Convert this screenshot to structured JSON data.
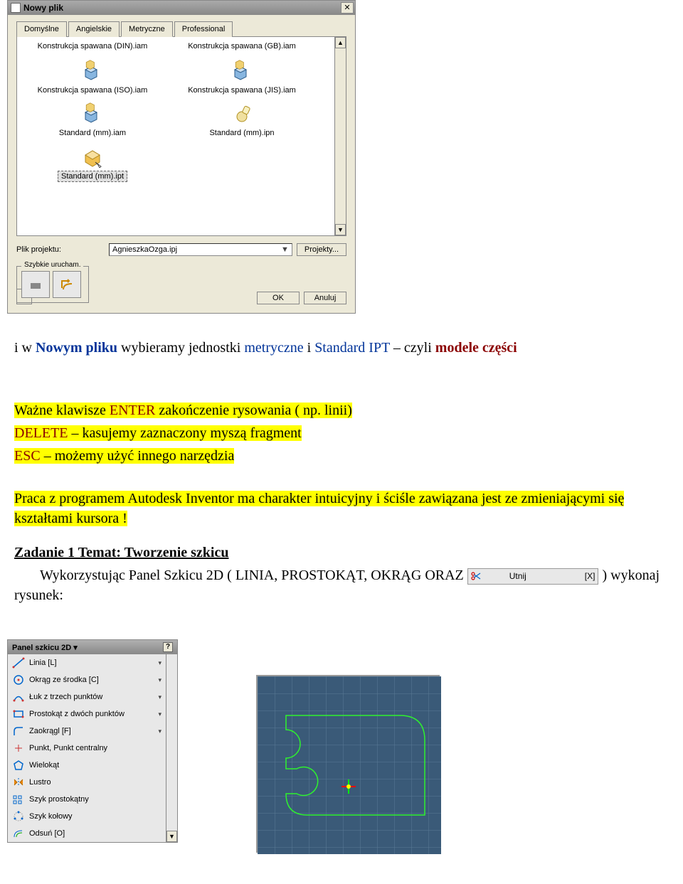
{
  "dialog": {
    "title": "Nowy plik",
    "tabs": [
      "Domyślne",
      "Angielskie",
      "Metryczne",
      "Professional"
    ],
    "active_tab": 2,
    "files": [
      {
        "label": "Konstrukcja spawana (DIN).iam",
        "type": "iam",
        "truncated": true
      },
      {
        "label": "Konstrukcja spawana (GB).iam",
        "type": "iam",
        "truncated": true
      },
      {
        "label": "Konstrukcja spawana (ISO).iam",
        "type": "iam"
      },
      {
        "label": "Konstrukcja spawana (JIS).iam",
        "type": "iam"
      },
      {
        "label": "Standard (mm).iam",
        "type": "iam"
      },
      {
        "label": "Standard (mm).ipn",
        "type": "ipn"
      },
      {
        "label": "Standard (mm).ipt",
        "type": "ipt",
        "selected": true
      }
    ],
    "project_label": "Plik projektu:",
    "project_value": "AgnieszkaOzga.ipj",
    "projects_btn": "Projekty...",
    "quick_launch_label": "Szybkie urucham.",
    "ok": "OK",
    "cancel": "Anuluj"
  },
  "doc": {
    "line1_pre": "i w ",
    "line1_blue1": "Nowym pliku",
    "line1_mid": " wybieramy jednostki ",
    "line1_blue2": "metryczne",
    "line1_mid2": " i ",
    "line1_blue3": "Standard IPT",
    "line1_mid3": " – czyli ",
    "line1_red": "modele części",
    "keys_pre": "Ważne klawisze ",
    "keys_enter": "ENTER",
    "keys_enter_desc": "  zakończenie rysowania ( np. linii)",
    "keys_delete": " DELETE",
    "keys_delete_desc": " – kasujemy zaznaczony myszą fragment",
    "keys_esc": " ESC",
    "keys_esc_desc": " – możemy użyć  innego narzędzia",
    "para2": "Praca z programem Autodesk Inventor ma charakter intuicyjny i ściśle zawiązana jest ze zmieniającymi się kształtami kursora !",
    "task_title": "Zadanie 1 Temat: Tworzenie szkicu",
    "task_text": "Wykorzystując Panel Szkicu 2D ( LINIA, PROSTOKĄT, OKRĄG ORAZ ",
    "utnij_label": "Utnij",
    "utnij_key": "[X]",
    "task_tail": ") wykonaj rysunek:"
  },
  "panel": {
    "title": "Panel szkicu 2D",
    "help": "?",
    "tools": [
      {
        "label": "Linia  [L]",
        "icon": "line",
        "arrow": true
      },
      {
        "label": "Okrąg ze środka   [C]",
        "icon": "circle",
        "arrow": true
      },
      {
        "label": "Łuk z trzech punktów",
        "icon": "arc",
        "arrow": true
      },
      {
        "label": "Prostokąt z dwóch punktów",
        "icon": "rect",
        "arrow": true
      },
      {
        "label": "Zaokrągl  [F]",
        "icon": "fillet",
        "arrow": true
      },
      {
        "label": "Punkt, Punkt centralny",
        "icon": "point"
      },
      {
        "label": "Wielokąt",
        "icon": "polygon"
      },
      {
        "label": "Lustro",
        "icon": "mirror"
      },
      {
        "label": "Szyk prostokątny",
        "icon": "rectarray"
      },
      {
        "label": "Szyk kołowy",
        "icon": "circarray"
      },
      {
        "label": "Odsuń  [O]",
        "icon": "offset"
      }
    ]
  }
}
